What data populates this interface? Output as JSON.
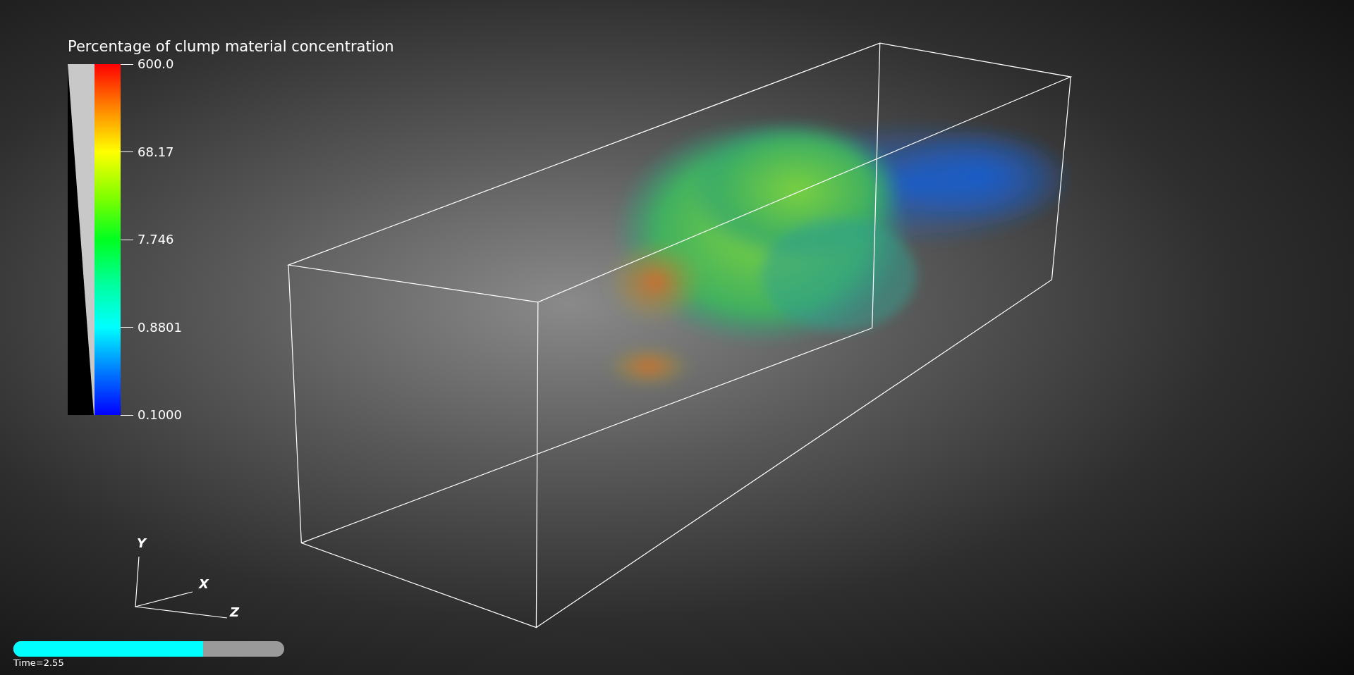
{
  "scalar_bar": {
    "title": "Percentage of clump material concentration",
    "labels": [
      "600.0",
      "68.17",
      "7.746",
      "0.8801",
      "0.1000"
    ]
  },
  "orientation_axes": {
    "labels": [
      "Y",
      "X",
      "Z"
    ]
  },
  "time": {
    "label": "Time=2.55",
    "level": 0.7
  }
}
